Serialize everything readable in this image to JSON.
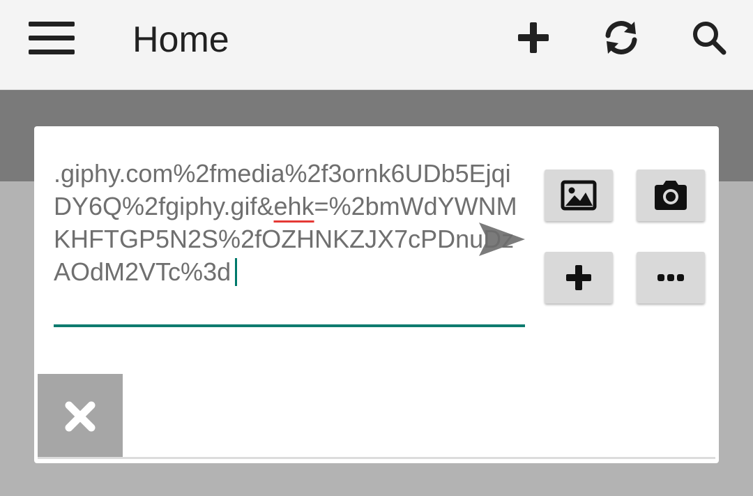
{
  "app_bar": {
    "title": "Home",
    "icons": {
      "menu": "hamburger-menu-icon",
      "add": "plus-icon",
      "refresh": "refresh-icon",
      "search": "search-icon"
    }
  },
  "compose": {
    "message_before_marked": ".giphy.com%2fmedia%2f3ornk6UDb5EjqiDY6Q%2fgiphy.gif&",
    "message_marked_word": "ehk",
    "message_after_marked": "=%2bmWdYWNMKHFTGP5N2S%2fOZHNKZJX7cPDnuDzAOdM2VTc%3d",
    "send_icon": "send-icon",
    "buttons": {
      "image": "image-icon",
      "camera": "camera-icon",
      "add": "plus-icon",
      "more": "more-horizontal-icon",
      "close": "close-icon"
    }
  },
  "colors": {
    "accent_teal": "#0e7b6f",
    "spellcheck_red": "#e53935",
    "app_bar_bg": "#f4f4f4",
    "scrim_dark": "#7a7a7a",
    "scrim_light": "#b3b3b3"
  }
}
